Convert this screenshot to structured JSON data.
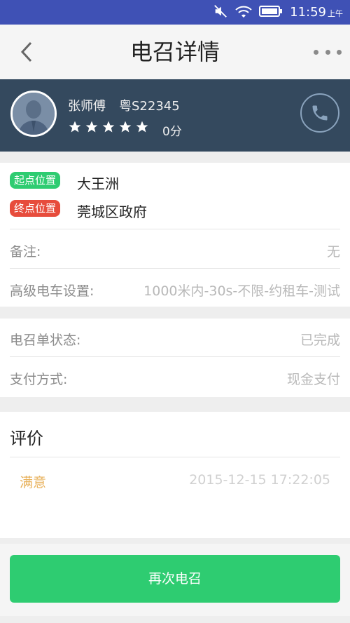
{
  "status_bar": {
    "time": "11:59",
    "ampm": "上午",
    "icons": [
      "mute-icon",
      "wifi-icon",
      "battery-icon"
    ]
  },
  "header": {
    "title": "电召详情",
    "back_icon": "chevron-left-icon",
    "more_icon": "more-dots-icon"
  },
  "driver": {
    "name": "张师傅",
    "plate": "粤S22345",
    "rating_stars": 5,
    "score": "0分"
  },
  "trip": {
    "start_tag": "起点位置",
    "start_location": "大王洲",
    "end_tag": "终点位置",
    "end_location": "莞城区政府",
    "note_label": "备注:",
    "note_value": "无",
    "advanced_label": "高级电车设置:",
    "advanced_value": "1000米内-30s-不限-约租车-测试"
  },
  "order": {
    "status_label": "电召单状态:",
    "status_value": "已完成",
    "payment_label": "支付方式:",
    "payment_value": "现金支付"
  },
  "evaluation": {
    "title": "评价",
    "level": "满意",
    "time": "2015-12-15 17:22:05"
  },
  "actions": {
    "recall_label": "再次电召"
  },
  "colors": {
    "status_bar": "#3f51b5",
    "driver_panel": "#34495e",
    "green": "#2ecc71",
    "red": "#e74c3c"
  }
}
